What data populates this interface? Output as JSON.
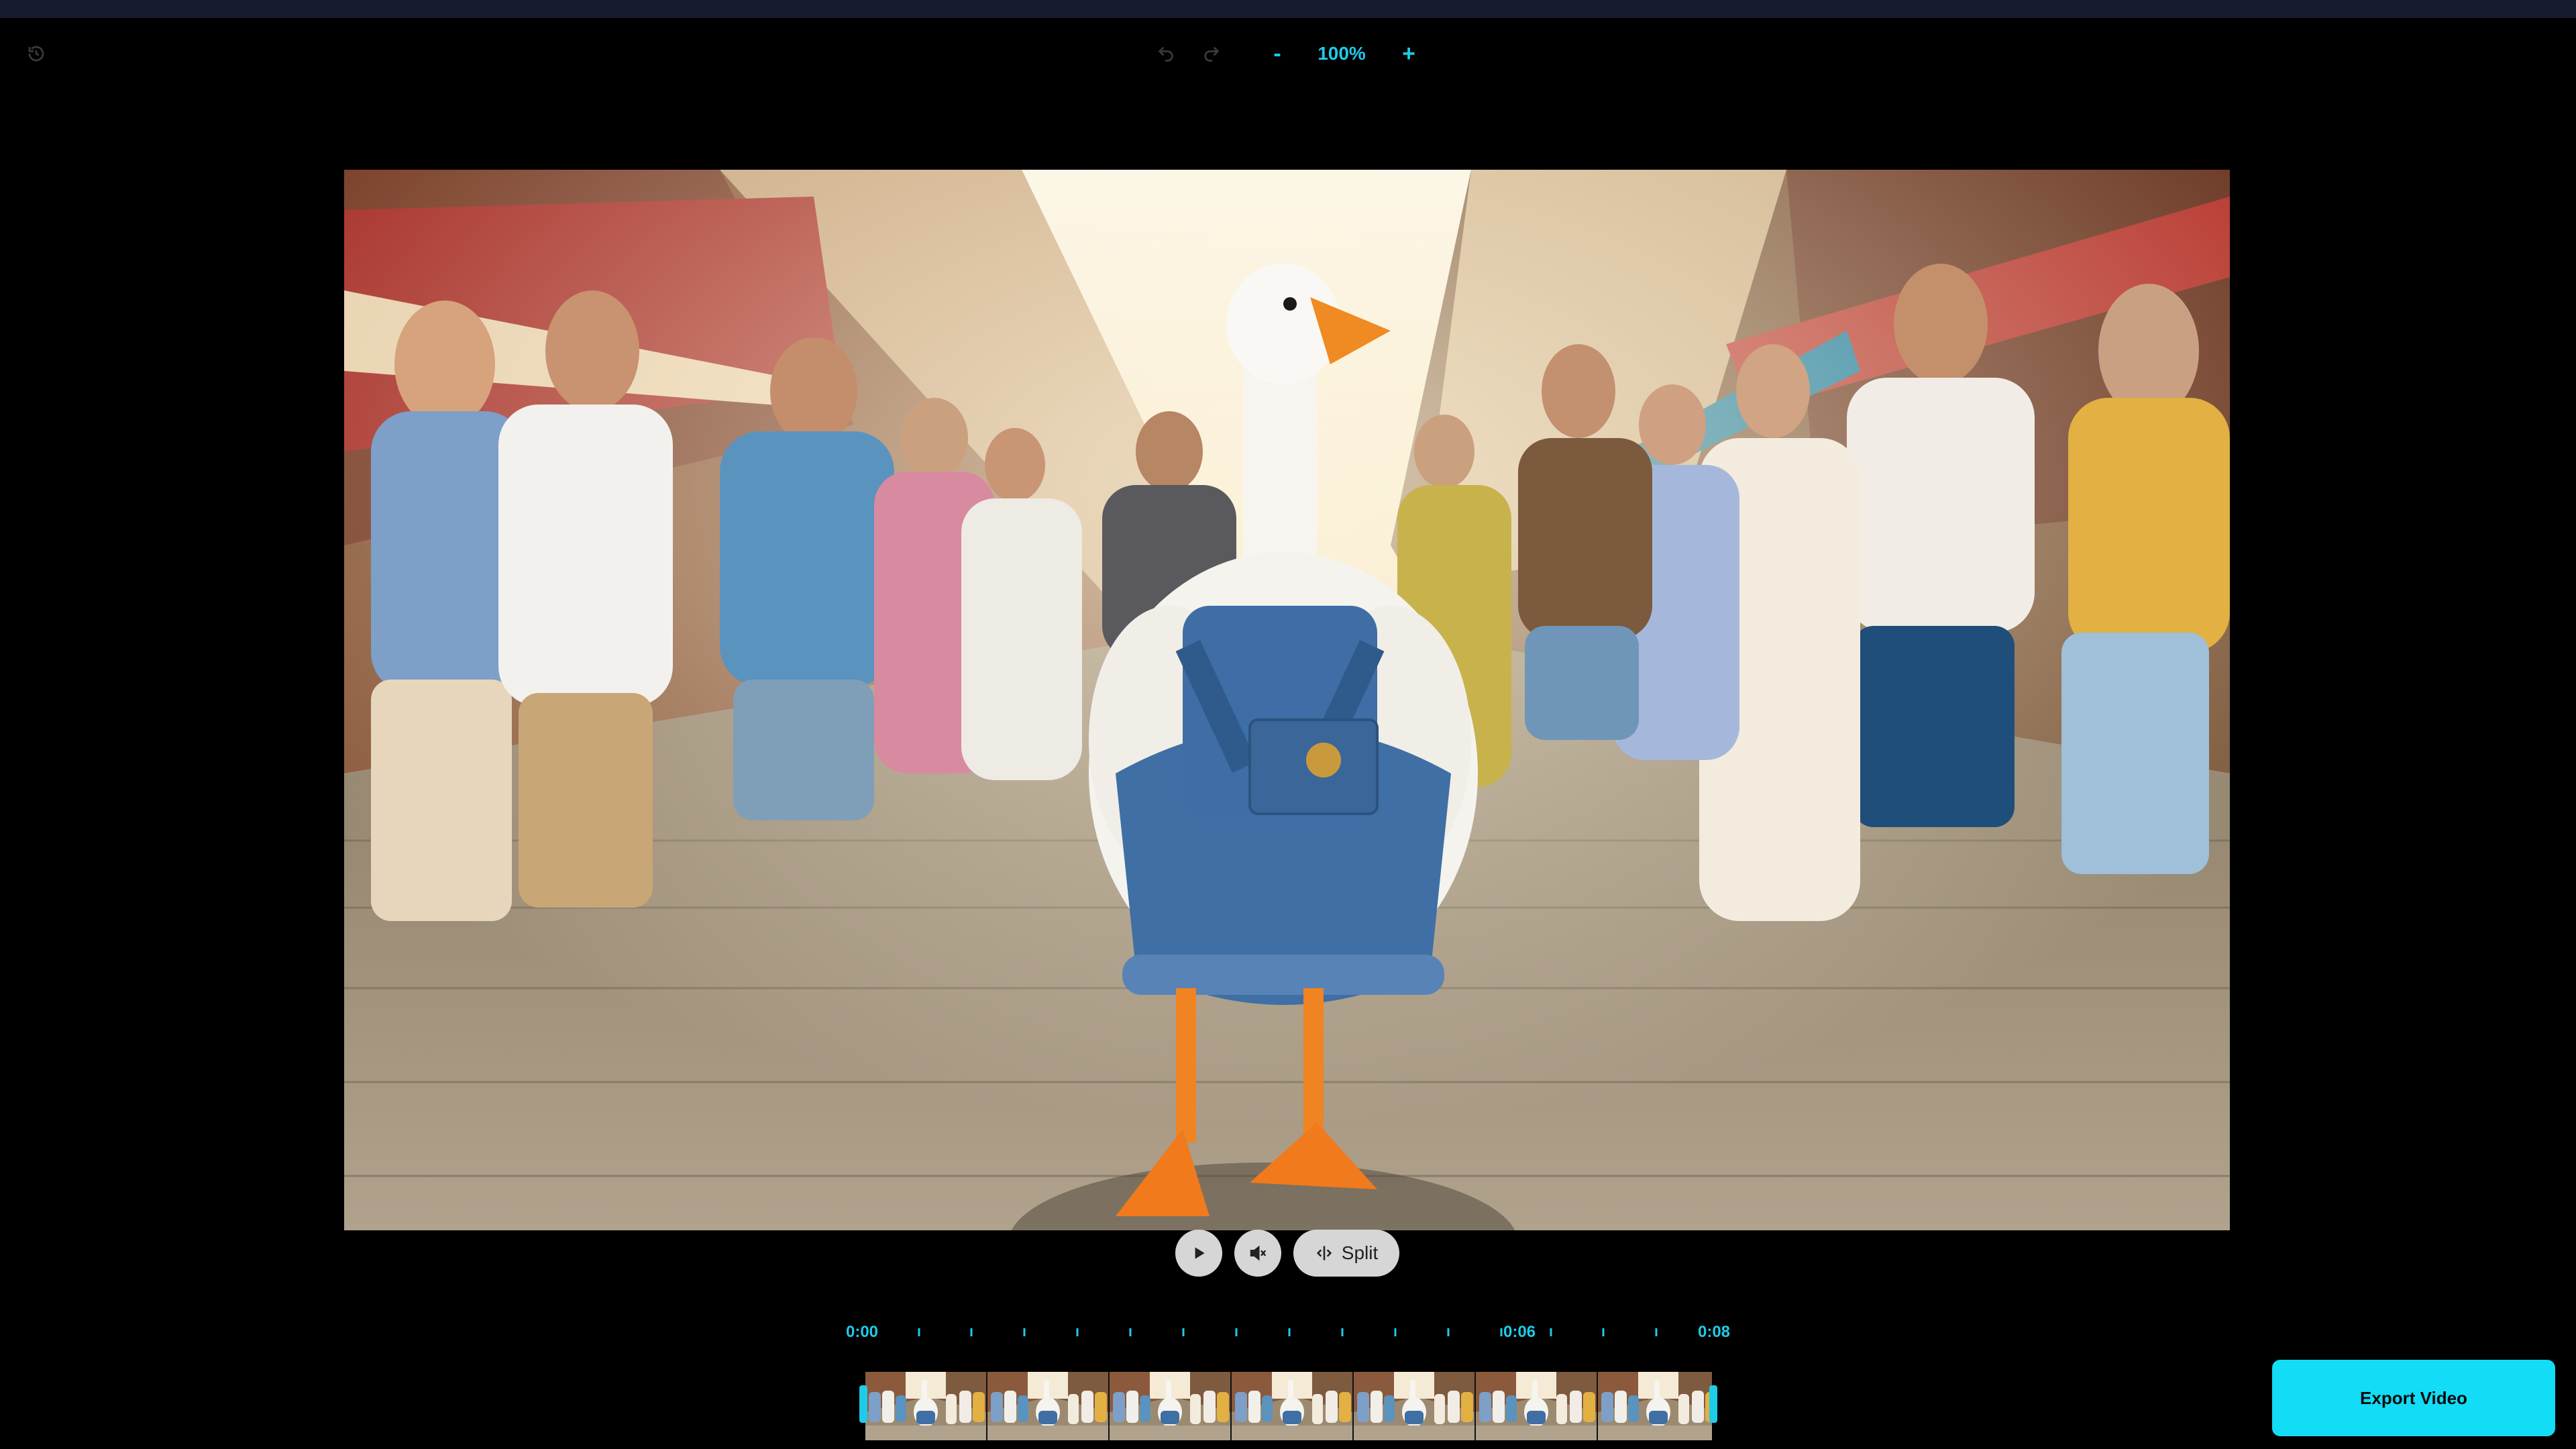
{
  "toolbar": {
    "zoom_value": "100%",
    "zoom_out_label": "-",
    "zoom_in_label": "+",
    "history_icon": "history-icon",
    "undo_icon": "undo-icon",
    "redo_icon": "redo-icon",
    "accent_color": "#1ecbe8"
  },
  "playback": {
    "play_icon": "play-icon",
    "mute_icon": "mute-icon",
    "split_label": "Split",
    "split_icon": "split-icon"
  },
  "timeline": {
    "start_label": "0:00",
    "mid_label": "0:06",
    "end_label": "0:08",
    "frame_count": 7
  },
  "actions": {
    "export_label": "Export Video",
    "export_color": "#12dcf6"
  }
}
